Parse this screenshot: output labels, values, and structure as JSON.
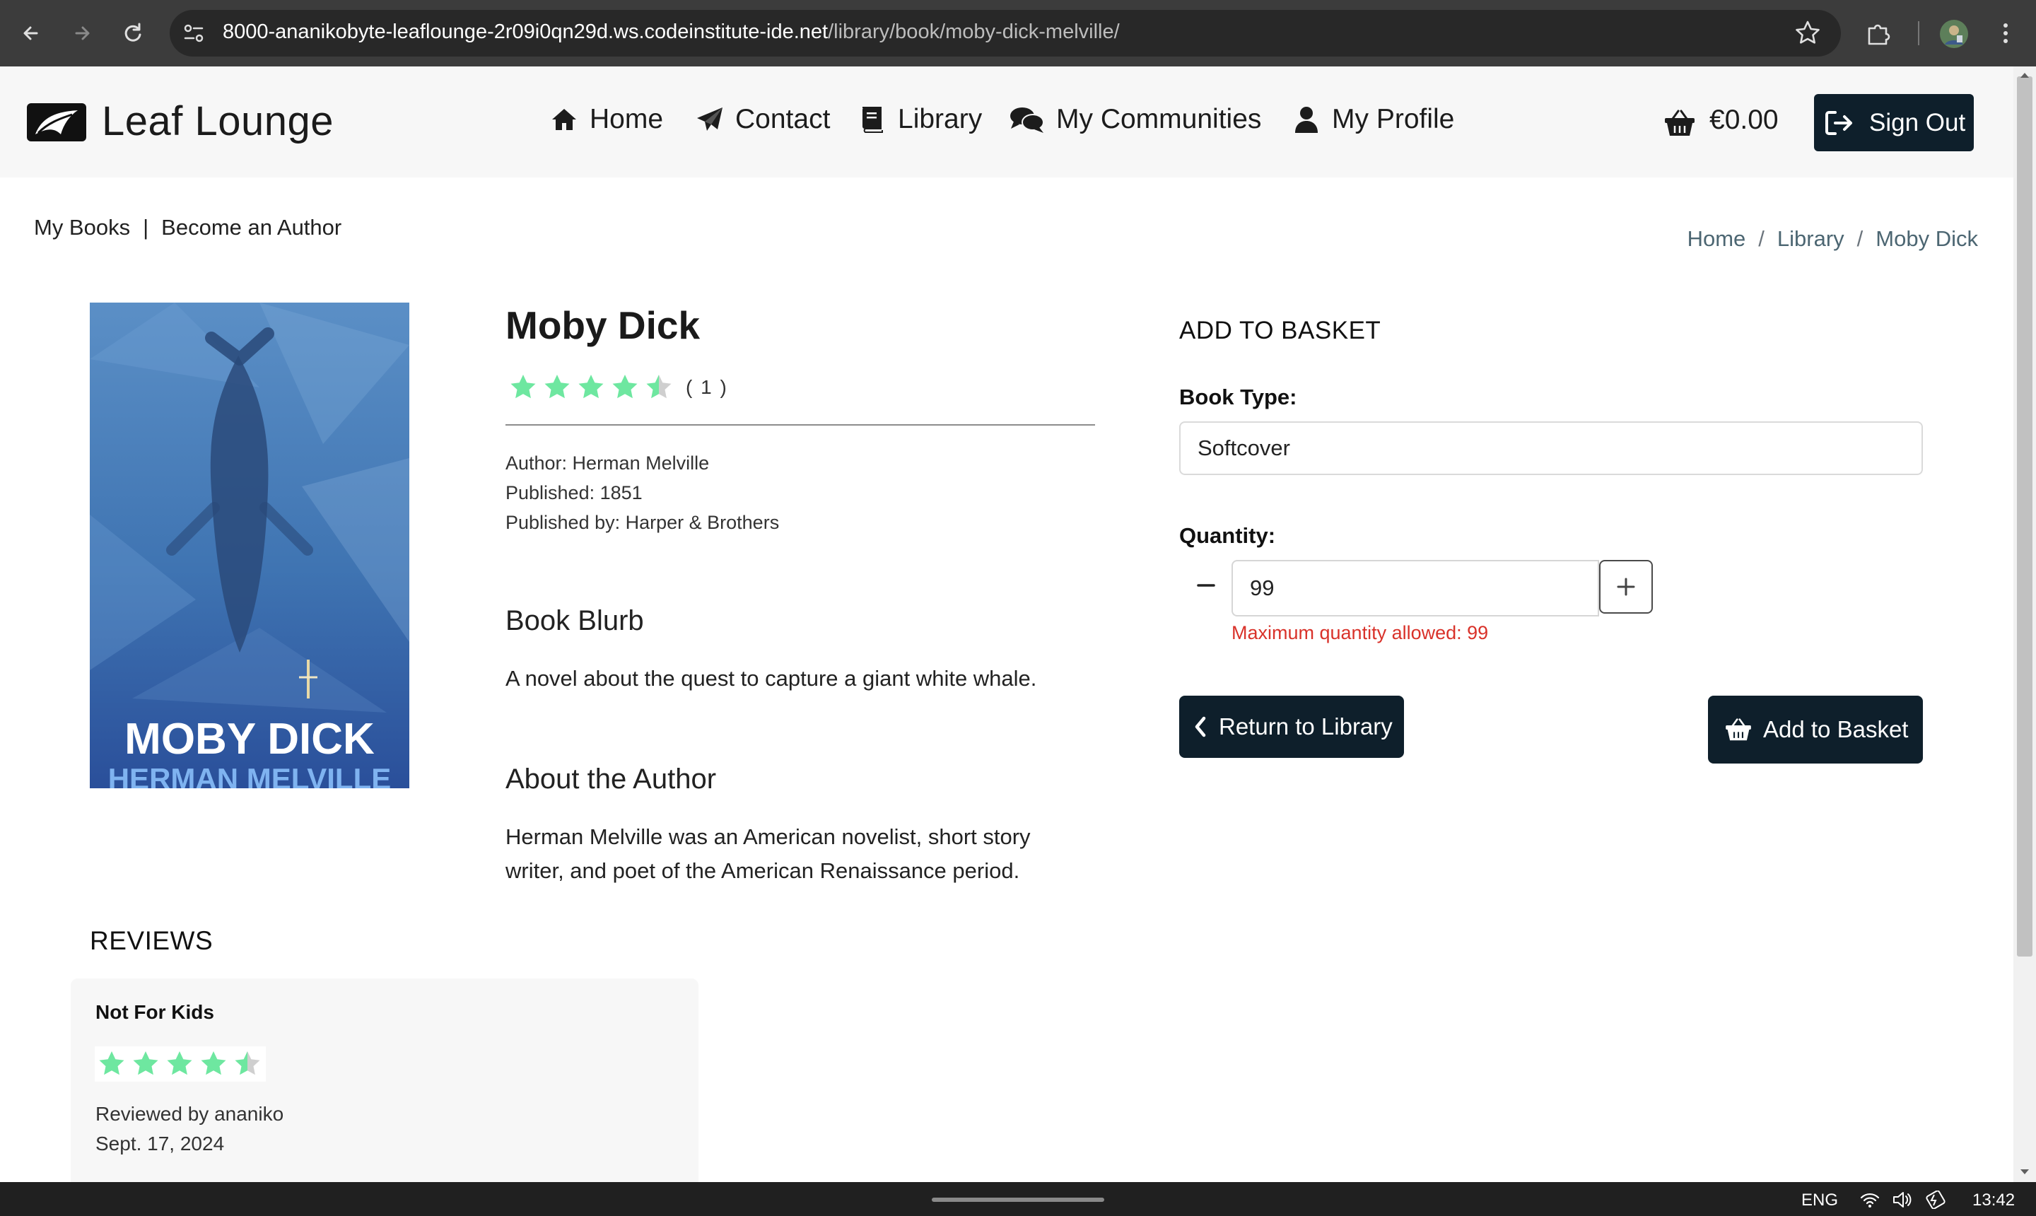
{
  "browser": {
    "url_host": "8000-ananikobyte-leaflounge-2r09i0qn29d.ws.codeinstitute-ide.net",
    "url_path": "/library/book/moby-dick-melville/"
  },
  "taskbar": {
    "language": "ENG",
    "time": "13:42"
  },
  "header": {
    "brand": "Leaf Lounge",
    "nav": [
      {
        "label": "Home",
        "icon": "home-icon"
      },
      {
        "label": "Contact",
        "icon": "paper-plane-icon"
      },
      {
        "label": "Library",
        "icon": "book-icon"
      },
      {
        "label": "My Communities",
        "icon": "comments-icon"
      },
      {
        "label": "My Profile",
        "icon": "user-icon"
      }
    ],
    "basket_total": "€0.00",
    "sign_out": "Sign Out"
  },
  "subnav": {
    "my_books": "My Books",
    "separator": "|",
    "become_author": "Become an Author"
  },
  "breadcrumb": {
    "home": "Home",
    "library": "Library",
    "current": "Moby Dick",
    "separator": "/"
  },
  "book": {
    "title": "Moby Dick",
    "rating": 4.5,
    "rating_count": "( 1 )",
    "author_line": "Author: Herman Melville",
    "published_line": "Published: 1851",
    "publisher_line": "Published by: Harper & Brothers",
    "blurb_heading": "Book Blurb",
    "blurb": "A novel about the quest to capture a giant white whale.",
    "about_heading": "About the Author",
    "about": "Herman Melville was an American novelist, short story writer, and poet of the American Renaissance period.",
    "cover_title": "MOBY DICK",
    "cover_author": "HERMAN MELVILLE"
  },
  "basket_form": {
    "heading": "ADD TO BASKET",
    "book_type_label": "Book Type:",
    "book_type_value": "Softcover",
    "quantity_label": "Quantity:",
    "quantity_value": "99",
    "quantity_error": "Maximum quantity allowed: 99",
    "return_button": "Return to Library",
    "add_button": "Add to Basket"
  },
  "reviews": {
    "heading": "REVIEWS",
    "items": [
      {
        "title": "Not For Kids",
        "rating": 4.5,
        "reviewer": "Reviewed by ananiko",
        "date": "Sept. 17, 2024"
      }
    ]
  },
  "colors": {
    "accent_dark": "#0e1f2b",
    "star_green": "#6ee7a0",
    "error_red": "#d9322a"
  }
}
